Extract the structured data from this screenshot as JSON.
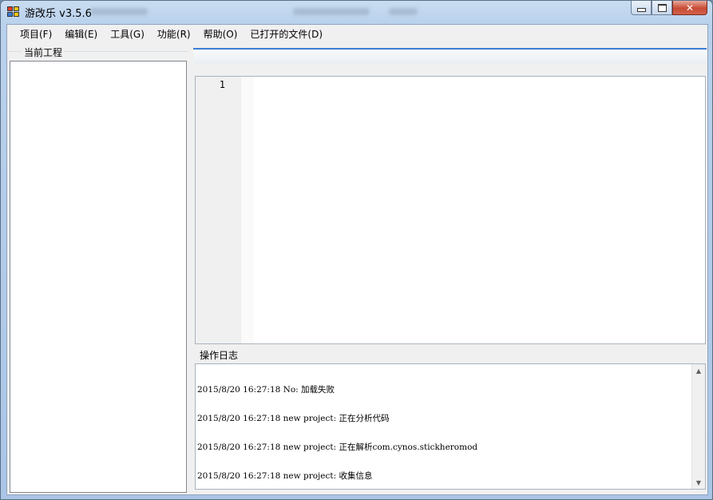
{
  "window": {
    "title": "游改乐 v3.5.6",
    "buttons": {
      "minimize": "minimize-icon",
      "maximize": "maximize-icon",
      "close": "✕"
    }
  },
  "menu": [
    {
      "label": "项目(F)"
    },
    {
      "label": "编辑(E)"
    },
    {
      "label": "工具(G)"
    },
    {
      "label": "功能(R)"
    },
    {
      "label": "帮助(O)"
    },
    {
      "label": "已打开的文件(D)"
    }
  ],
  "project_panel": {
    "title": "当前工程"
  },
  "editor": {
    "line_numbers": [
      "1"
    ]
  },
  "log": {
    "title": "操作日志",
    "lines": [
      "2015/8/20 16:27:18 No: 加载失败",
      "2015/8/20 16:27:18 new project: 正在分析代码",
      "2015/8/20 16:27:18 new project: 正在解析com.cynos.stickheromod",
      "2015/8/20 16:27:18 new project: 收集信息"
    ],
    "scroll_up": "▲",
    "scroll_down": "▼"
  },
  "colors": {
    "accent": "#3c7fd6",
    "title_bar": "#b9d1ec",
    "close_button": "#c74b35"
  }
}
